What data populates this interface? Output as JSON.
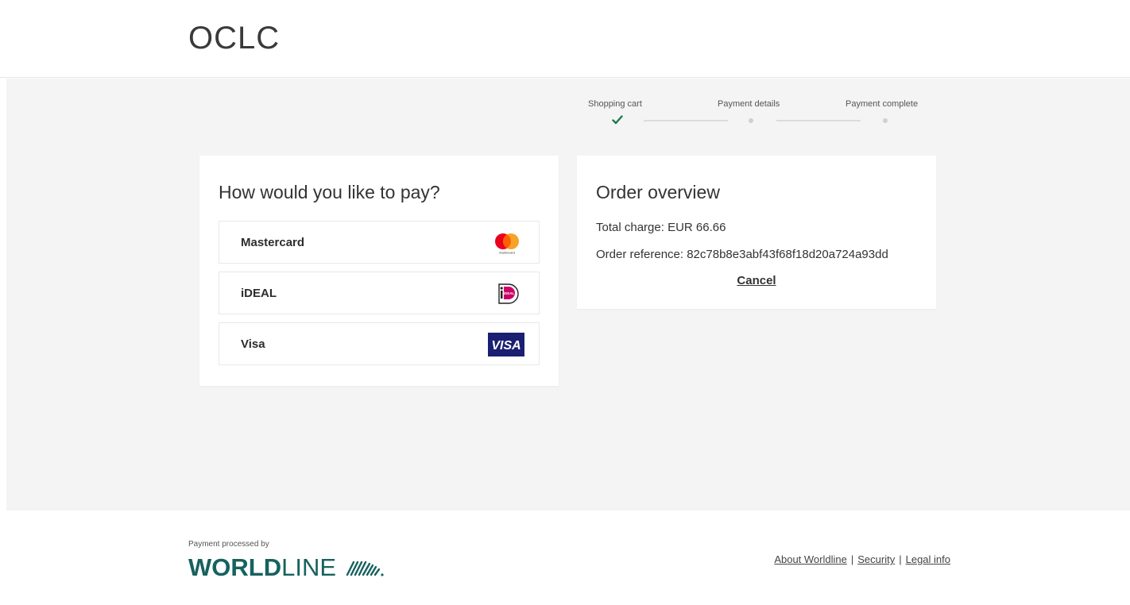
{
  "header": {
    "brand": "OCLC"
  },
  "steps": [
    {
      "label": "Shopping cart",
      "state": "done"
    },
    {
      "label": "Payment details",
      "state": "pending"
    },
    {
      "label": "Payment complete",
      "state": "pending"
    }
  ],
  "payment": {
    "title": "How would you like to pay?",
    "methods": [
      {
        "label": "Mastercard",
        "icon": "mastercard-logo-icon",
        "logo_caption": "mastercard"
      },
      {
        "label": "iDEAL",
        "icon": "ideal-logo-icon",
        "logo_caption": "iDEAL"
      },
      {
        "label": "Visa",
        "icon": "visa-logo-icon",
        "logo_caption": "VISA"
      }
    ]
  },
  "order": {
    "title": "Order overview",
    "total_label": "Total charge:",
    "total_value": "EUR 66.66",
    "reference_label": "Order reference:",
    "reference_value": "82c78b8e3abf43f68f18d20a724a93dd",
    "cancel_label": "Cancel"
  },
  "footer": {
    "processed_by": "Payment processed by",
    "logo_bold": "WORLD",
    "logo_light": "LINE",
    "links": [
      "About Worldline",
      "Security",
      "Legal info"
    ]
  },
  "colors": {
    "check": "#1f7a4f",
    "worldline": "#16625f",
    "visa": "#1a1f71",
    "mastercard_red": "#eb001b",
    "mastercard_orange": "#f79e1b",
    "ideal_pink": "#cc0066"
  }
}
